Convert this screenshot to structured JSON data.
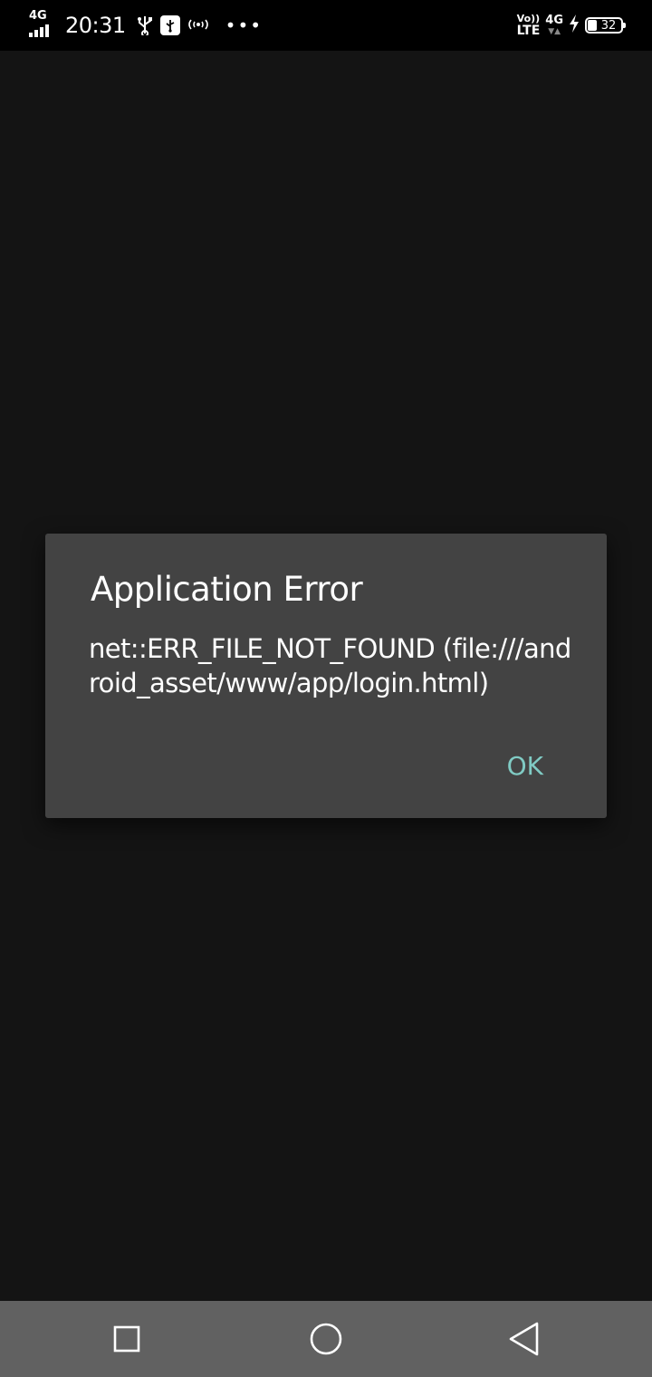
{
  "status_bar": {
    "network_type": "4G",
    "time": "20:31",
    "volte_label": "Vo))",
    "lte_label": "LTE",
    "right_network_type": "4G",
    "battery_percent": "32",
    "icons": [
      "signal-icon",
      "usb-icon",
      "usb-debug-icon",
      "hotspot-icon",
      "more-notifications-icon",
      "volte-icon",
      "data-activity-icon",
      "charging-icon",
      "battery-icon"
    ]
  },
  "dialog": {
    "title": "Application Error",
    "message": "net::ERR_FILE_NOT_FOUND (file:///android_asset/www/app/login.html)",
    "ok_label": "OK",
    "ok_color": "#80cbc4"
  },
  "nav_bar": {
    "icons": [
      "recents-icon",
      "home-icon",
      "back-icon"
    ]
  },
  "colors": {
    "background": "#141414",
    "dialog_background": "#434343",
    "nav_background": "#616161",
    "status_background": "#000000"
  }
}
